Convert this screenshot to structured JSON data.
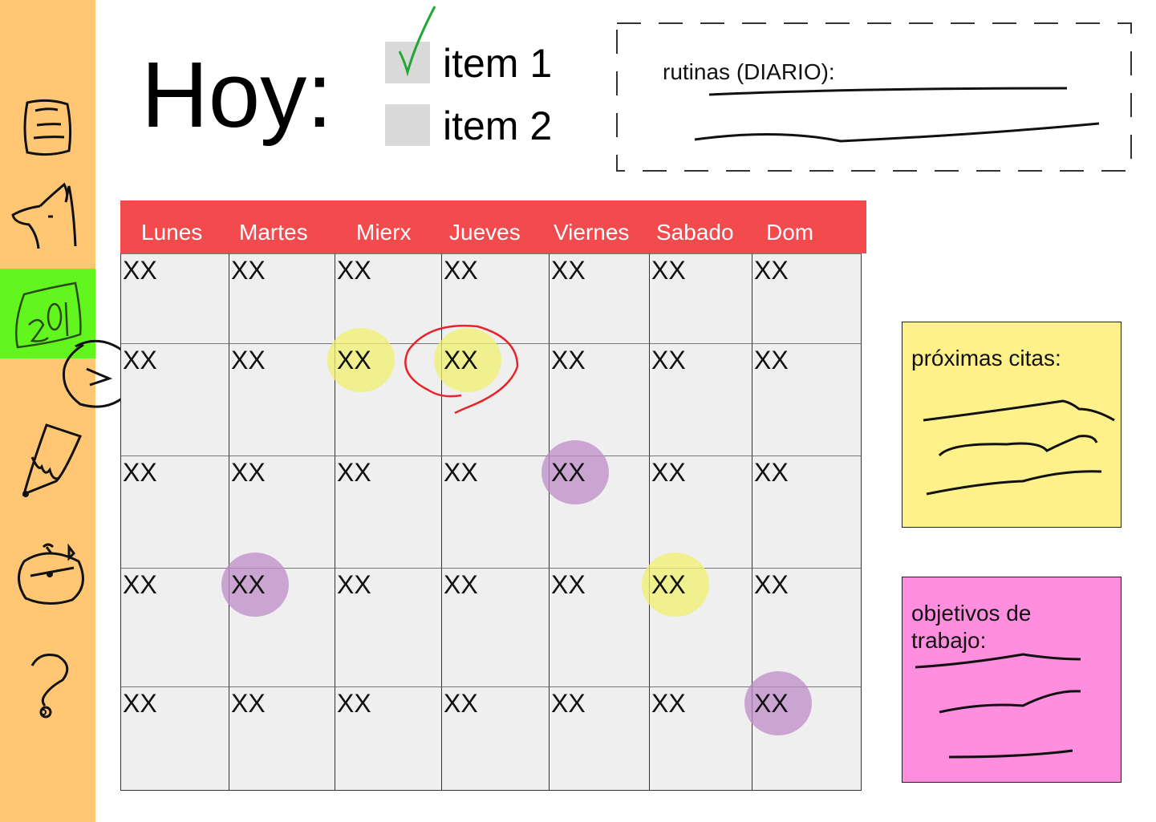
{
  "page": {
    "title": "Hoy:"
  },
  "sidebar": {
    "items": [
      {
        "name": "notes-icon",
        "active": false
      },
      {
        "name": "dog-icon",
        "active": false
      },
      {
        "name": "calendar-icon",
        "active": true
      },
      {
        "name": "pencil-icon",
        "active": false
      },
      {
        "name": "stopwatch-icon",
        "active": false
      },
      {
        "name": "help-icon",
        "active": false
      }
    ],
    "collapse_icon": "chevron-right-icon",
    "active_color": "#62F51E",
    "background": "#FFC774"
  },
  "todos": [
    {
      "label": "item 1",
      "checked": true
    },
    {
      "label": "item 2",
      "checked": false
    }
  ],
  "routines": {
    "label": "rutinas (DIARIO):"
  },
  "calendar": {
    "header_color": "#F34A4E",
    "days": [
      "Lunes",
      "Martes",
      "Mierx",
      "Jueves",
      "Viernes",
      "Sabado",
      "Dom"
    ],
    "rows": [
      [
        "XX",
        "XX",
        "XX",
        "XX",
        "XX",
        "XX",
        "XX"
      ],
      [
        "XX",
        "XX",
        "XX",
        "XX",
        "XX",
        "XX",
        "XX"
      ],
      [
        "XX",
        "XX",
        "XX",
        "XX",
        "XX",
        "XX",
        "XX"
      ],
      [
        "XX",
        "XX",
        "XX",
        "XX",
        "XX",
        "XX",
        "XX"
      ],
      [
        "XX",
        "XX",
        "XX",
        "XX",
        "XX",
        "XX",
        "XX"
      ]
    ],
    "highlights": [
      {
        "row": 1,
        "col": 2,
        "color": "yellow"
      },
      {
        "row": 1,
        "col": 3,
        "color": "yellow",
        "circled": true
      },
      {
        "row": 2,
        "col": 4,
        "color": "purple"
      },
      {
        "row": 3,
        "col": 1,
        "color": "purple"
      },
      {
        "row": 3,
        "col": 5,
        "color": "yellow"
      },
      {
        "row": 4,
        "col": 6,
        "color": "purple"
      }
    ]
  },
  "notes": {
    "citas": {
      "title": "próximas citas:",
      "color": "#FFF18A"
    },
    "objetivos": {
      "title": "objetivos de trabajo:",
      "color": "#FF8EDE"
    }
  }
}
